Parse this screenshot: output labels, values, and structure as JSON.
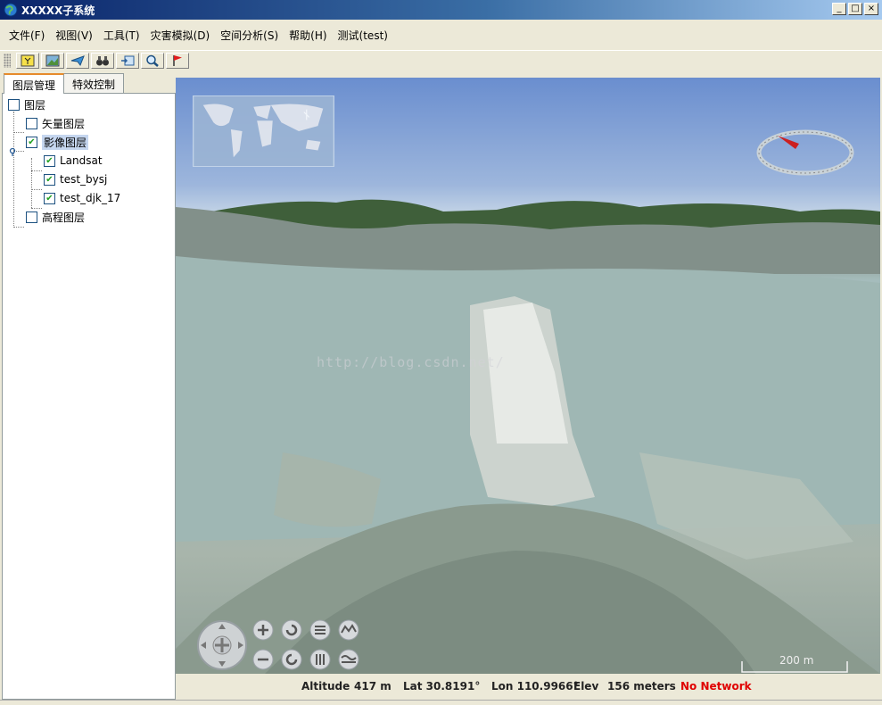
{
  "window": {
    "title": "XXXXX子系统",
    "controls": {
      "minimize": "_",
      "maximize": "□",
      "close": "×"
    }
  },
  "menubar": [
    {
      "label": "文件(F)"
    },
    {
      "label": "视图(V)"
    },
    {
      "label": "工具(T)"
    },
    {
      "label": "灾害模拟(D)"
    },
    {
      "label": "空间分析(S)"
    },
    {
      "label": "帮助(H)"
    },
    {
      "label": "测试(test)"
    }
  ],
  "toolbar": {
    "icons": [
      "new-layer-icon",
      "image-icon",
      "fly-icon",
      "binoculars-icon",
      "export-icon",
      "zoom-icon",
      "flag-icon"
    ]
  },
  "left_panel": {
    "tabs": [
      {
        "label": "图层管理",
        "active": true
      },
      {
        "label": "特效控制",
        "active": false
      }
    ],
    "tree": {
      "root": {
        "label": "图层",
        "checked": false
      },
      "vector": {
        "label": "矢量图层",
        "checked": false
      },
      "imagery": {
        "label": "影像图层",
        "checked": true,
        "children": [
          {
            "label": "Landsat",
            "checked": true
          },
          {
            "label": "test_bysj",
            "checked": true
          },
          {
            "label": "test_djk_17",
            "checked": true
          }
        ]
      },
      "elevation": {
        "label": "高程图层",
        "checked": false
      }
    }
  },
  "globe": {
    "watermark": "http://blog.csdn.net/",
    "scale_label": "200 m"
  },
  "statusbar": {
    "altitude_label": "Altitude",
    "altitude_value": "417 m",
    "lat": "Lat 30.8191°",
    "lon": "Lon 110.9966°",
    "elev_label": "Elev",
    "elev_value": "156 meters",
    "network": "No Network",
    "network_color": "#e00000"
  }
}
